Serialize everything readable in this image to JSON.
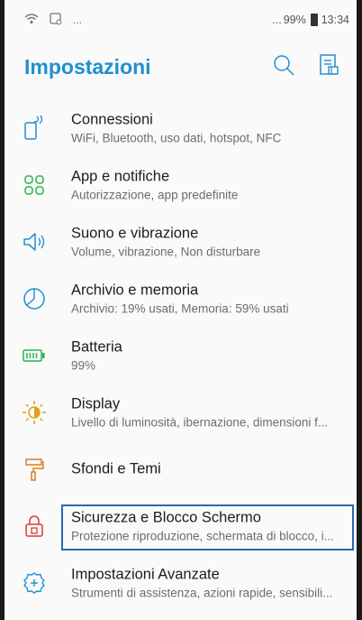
{
  "status_bar": {
    "left_extra": "...",
    "right_extra": "...",
    "battery": "99%",
    "time": "13:34"
  },
  "header": {
    "title": "Impostazioni"
  },
  "items": [
    {
      "title": "Connessioni",
      "subtitle": "WiFi, Bluetooth, uso dati, hotspot, NFC",
      "icon": "connections-icon",
      "color": "#1f8fd1"
    },
    {
      "title": "App e notifiche",
      "subtitle": "Autorizzazione, app predefinite",
      "icon": "apps-grid-icon",
      "color": "#2bb34b"
    },
    {
      "title": "Suono e vibrazione",
      "subtitle": "Volume, vibrazione, Non disturbare",
      "icon": "speaker-icon",
      "color": "#1f8fd1"
    },
    {
      "title": "Archivio e memoria",
      "subtitle": "Archivio: 19% usati, Memoria: 59% usati",
      "icon": "storage-pie-icon",
      "color": "#1f8fd1"
    },
    {
      "title": "Batteria",
      "subtitle": "99%",
      "icon": "battery-icon",
      "color": "#2bb34b"
    },
    {
      "title": "Display",
      "subtitle": "Livello di luminosità, ibernazione, dimensioni f...",
      "icon": "brightness-icon",
      "color": "#e0a21e"
    },
    {
      "title": "Sfondi e Temi",
      "subtitle": "",
      "icon": "paint-roller-icon",
      "color": "#e07b1e"
    },
    {
      "title": "Sicurezza e Blocco Schermo",
      "subtitle": "Protezione riproduzione, schermata di blocco, i...",
      "icon": "lock-icon",
      "color": "#d93b3b"
    },
    {
      "title": "Impostazioni Avanzate",
      "subtitle": "Strumenti di assistenza, azioni rapide, sensibili...",
      "icon": "advanced-gear-icon",
      "color": "#1f8fd1"
    }
  ]
}
